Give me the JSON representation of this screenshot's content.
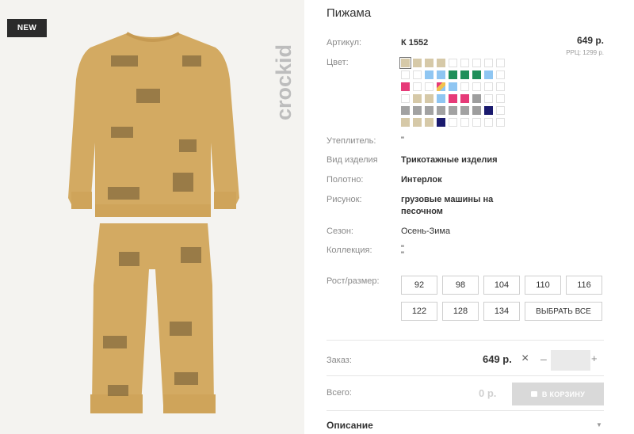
{
  "product": {
    "badge": "NEW",
    "brand_logo_text": "crockid",
    "title": "Пижама"
  },
  "details": {
    "article_label": "Артикул:",
    "article_value": "К 1552",
    "price": "649 р.",
    "rrp": "РРЦ: 1299 р.",
    "color_label": "Цвет:",
    "insulation_label": "Утеплитель:",
    "insulation_value": "\"",
    "type_label": "Вид изделия",
    "type_value": "Трикотажные изделия",
    "fabric_label": "Полотно:",
    "fabric_value": "Интерлок",
    "pattern_label": "Рисунок:",
    "pattern_value_line1": "грузовые машины на",
    "pattern_value_line2": "песочном",
    "season_label": "Сезон:",
    "season_value": "Осень-Зима",
    "collection_label": "Коллекция:",
    "collection_value_line1": "\"",
    "collection_value_line2": "\"",
    "size_label": "Рост/размер:"
  },
  "colors": [
    [
      "#d6c9a8",
      "#d6c9a8",
      "#d6c9a8",
      "#d6c9a8",
      "",
      "",
      "",
      "",
      ""
    ],
    [
      "",
      "",
      "#8fc6f2",
      "#8fc6f2",
      "#1f8f5a",
      "#1f8f5a",
      "#1f8f5a",
      "#8fc6f2",
      ""
    ],
    [
      "#e63a78",
      "",
      "",
      "multi",
      "#8fc6f2",
      "",
      "",
      "",
      ""
    ],
    [
      "",
      "#d6c9a8",
      "#d6c9a8",
      "#8fc6f2",
      "#e63a78",
      "#e63a78",
      "#9e9e9e",
      "",
      ""
    ],
    [
      "#a2a2a2",
      "#a2a2a2",
      "#a2a2a2",
      "#a2a2a2",
      "#a2a2a2",
      "#a2a2a2",
      "#9e9e9e",
      "#1a1a6e",
      ""
    ],
    [
      "#d6c9a8",
      "#d6c9a8",
      "#d6c9a8",
      "#1a1a6e",
      "",
      "",
      "",
      "",
      ""
    ]
  ],
  "sizes": [
    "92",
    "98",
    "104",
    "110",
    "116",
    "122",
    "128",
    "134"
  ],
  "select_all_label": "ВЫБРАТЬ ВСЕ",
  "order": {
    "order_label": "Заказ:",
    "order_price": "649 р.",
    "times_symbol": "×",
    "minus_symbol": "–",
    "plus_symbol": "+",
    "quantity": "",
    "total_label": "Всего:",
    "total_price": "0 р.",
    "cart_button_label": "В КОРЗИНУ"
  },
  "description": {
    "label": "Описание",
    "toggle_icon": "▼"
  }
}
